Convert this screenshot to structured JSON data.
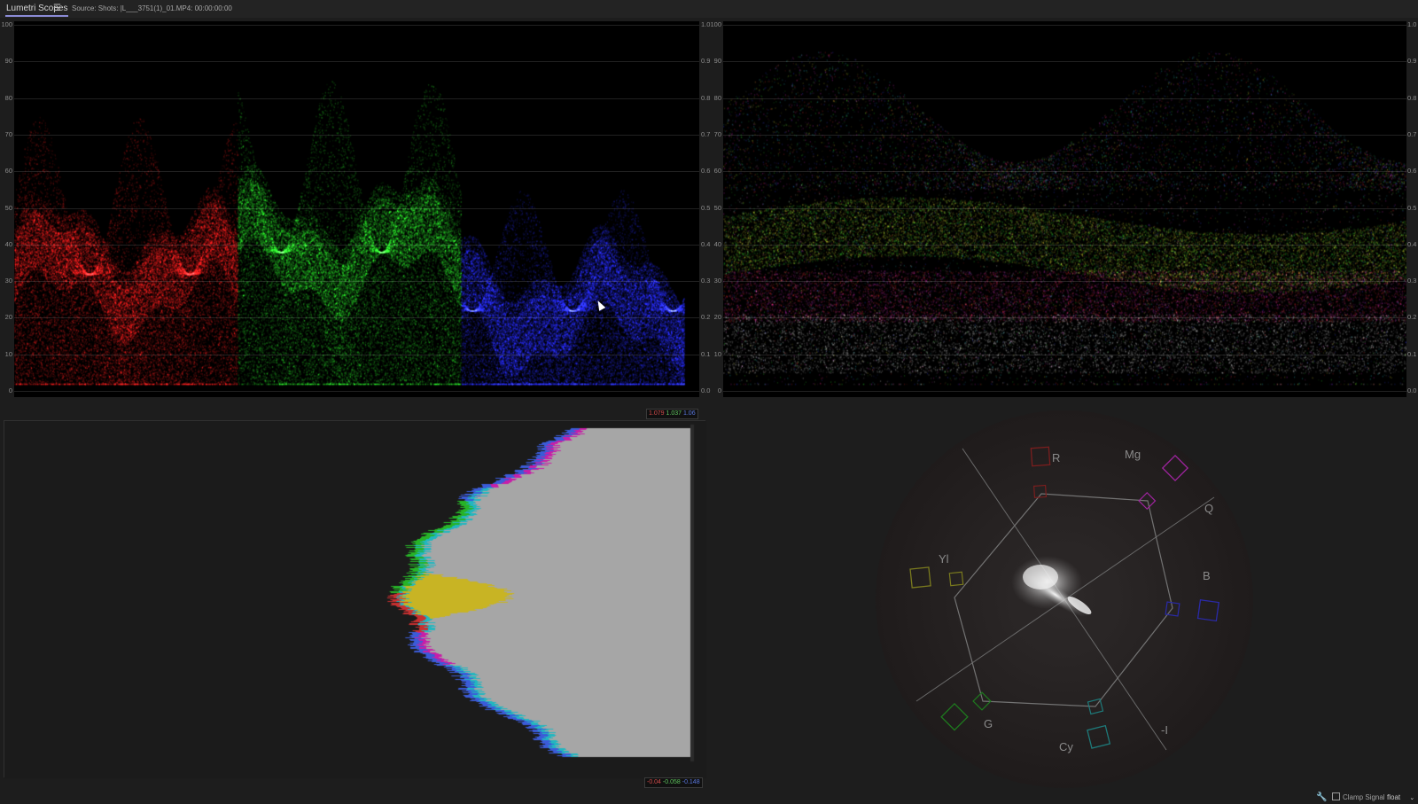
{
  "panel": {
    "tab_label": "Lumetri Scopes",
    "menu_icon": "hamburger-menu-icon",
    "source": "Source: Shots: |L___3751(1)_01.MP4: 00:00:00:00"
  },
  "scales": {
    "ire": [
      "100",
      "90",
      "80",
      "70",
      "60",
      "50",
      "40",
      "30",
      "20",
      "10",
      "0"
    ],
    "unit": [
      "1.0",
      "0.9",
      "0.8",
      "0.7",
      "0.6",
      "0.5",
      "0.4",
      "0.3",
      "0.2",
      "0.1",
      "0.0"
    ]
  },
  "histogram": {
    "top_values": {
      "r": "1.079",
      "g": "1.037",
      "b": "1.06"
    },
    "bottom_values": {
      "r": "-0.04",
      "g": "-0.058",
      "b": "-0.148"
    }
  },
  "vectorscope": {
    "labels": {
      "r": "R",
      "mg": "Mg",
      "q": "Q",
      "b": "B",
      "yl": "Yl",
      "g": "G",
      "cy": "Cy",
      "i": "-I"
    }
  },
  "footer": {
    "settings_icon": "wrench-icon",
    "clamp_label": "Clamp Signal",
    "precision_value": "float",
    "dropdown_icon": "chevron-down-icon"
  },
  "colors": {
    "red": "#e01818",
    "green": "#1ec81e",
    "blue": "#1a22e8",
    "yellow": "#c8b424",
    "magenta": "#cc20b0",
    "cyan": "#20c0c8",
    "tab_underline": "#8b8bd6"
  }
}
